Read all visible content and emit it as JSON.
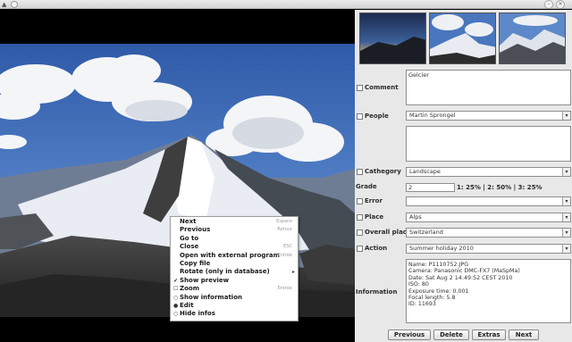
{
  "context_menu": {
    "items": [
      {
        "label": "Next",
        "shortcut": "Espace",
        "checked": false,
        "submenu": false
      },
      {
        "label": "Previous",
        "shortcut": "Retour",
        "checked": false,
        "submenu": false
      },
      {
        "label": "Go to",
        "shortcut": "",
        "checked": false,
        "submenu": false
      },
      {
        "label": "Close",
        "shortcut": "ESC",
        "checked": false,
        "submenu": false
      },
      {
        "label": "Open with external program",
        "shortcut": "Entrée",
        "checked": false,
        "submenu": false
      },
      {
        "label": "Copy file",
        "shortcut": "",
        "checked": false,
        "submenu": false
      },
      {
        "label": "Rotate (only in database)",
        "shortcut": "",
        "checked": false,
        "submenu": true
      },
      {
        "label": "Show preview",
        "shortcut": "",
        "checked": true,
        "submenu": false
      },
      {
        "label": "Zoom",
        "shortcut": "Entrée",
        "checked": false,
        "submenu": false
      },
      {
        "label": "Show information",
        "shortcut": "",
        "checked": false,
        "submenu": false
      },
      {
        "label": "Edit",
        "shortcut": "",
        "checked": false,
        "submenu": false
      },
      {
        "label": "Hide infos",
        "shortcut": "",
        "checked": false,
        "submenu": false
      }
    ]
  },
  "panel": {
    "comment": {
      "label": "Comment",
      "value": "Gelcier"
    },
    "people": {
      "label": "People",
      "value": "Martin Sprongel"
    },
    "category": {
      "label": "Cathegory",
      "value": "Landscape"
    },
    "grade": {
      "label": "Grade",
      "value": "2",
      "scale": "1: 25% | 2: 50% | 3: 25%"
    },
    "error": {
      "label": "Error",
      "value": ""
    },
    "place": {
      "label": "Place",
      "value": "Alps"
    },
    "overall_place": {
      "label": "Overall place",
      "value": "Switzerland"
    },
    "action": {
      "label": "Action",
      "value": "Summer holiday 2010"
    },
    "information": {
      "label": "Information",
      "lines": [
        "Name: P1110752.JPG",
        "Camera: Panasonic DMC-FX7 (MaSpMa)",
        "Date: Sat Aug 2 14:49:52 CEST 2010",
        "ISO: 80",
        "Exposure time: 0.001",
        "Focal length: 5.8",
        "ID: 11693"
      ]
    },
    "buttons": {
      "previous": "Previous",
      "delete": "Delete",
      "extras": "Extras",
      "next": "Next"
    }
  },
  "colors": {
    "sky": "#3d67b4",
    "panel": "#e8e8e8",
    "menu_bg": "#ffffff"
  }
}
